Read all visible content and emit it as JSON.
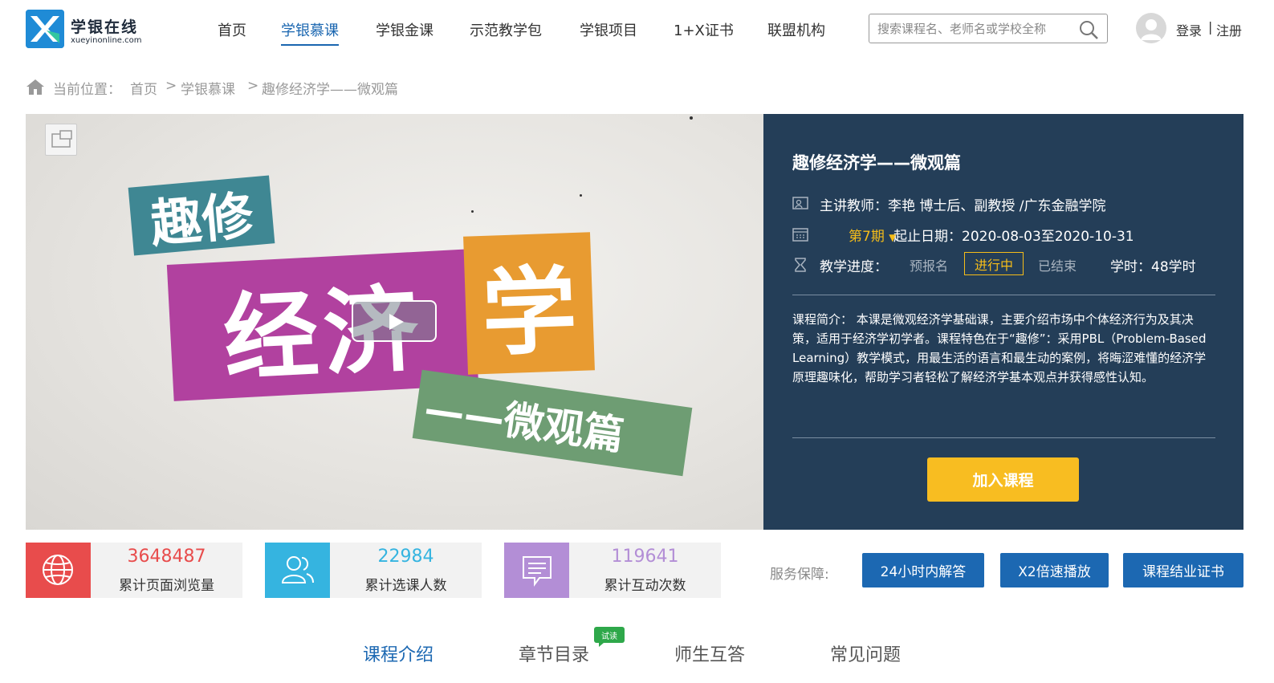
{
  "header": {
    "logo_title": "学银在线",
    "logo_sub": "xueyinonline.com",
    "nav": [
      {
        "label": "首页"
      },
      {
        "label": "学银慕课"
      },
      {
        "label": "学银金课"
      },
      {
        "label": "示范教学包"
      },
      {
        "label": "学银项目"
      },
      {
        "label": "1+X证书"
      },
      {
        "label": "联盟机构"
      }
    ],
    "search_placeholder": "搜索课程名、老师名或学校全称",
    "login": "登录",
    "separator": "|",
    "register": "注册"
  },
  "breadcrumb": {
    "label": "当前位置：",
    "items": [
      "首页",
      "学银慕课",
      "趣修经济学——微观篇"
    ],
    "sep": ">"
  },
  "video": {
    "card_teal": "趣修",
    "card_magenta": "经济",
    "card_orange": "学",
    "card_green": "——微观篇"
  },
  "course": {
    "title": "趣修经济学——微观篇",
    "teacher": "主讲教师：李艳 博士后、副教授 /广东金融学院",
    "term": "第7期",
    "date_label": "起止日期：2020-08-03至2020-10-31",
    "progress_label": "教学进度：",
    "status_signup": "预报名",
    "status_active": "进行中",
    "status_ended": "已结束",
    "hours": "学时：48学时",
    "intro": "课程简介： 本课是微观经济学基础课，主要介绍市场中个体经济行为及其决策，适用于经济学初学者。课程特色在于“趣修”：采用PBL（Problem-Based Learning）教学模式，用最生活的语言和最生动的案例，将晦涩难懂的经济学原理趣味化，帮助学习者轻松了解经济学基本观点并获得感性认知。",
    "join_button": "加入课程"
  },
  "stats": [
    {
      "value": "3648487",
      "label": "累计页面浏览量",
      "color": "#e84c4c"
    },
    {
      "value": "22984",
      "label": "累计选课人数",
      "color": "#35b4e0"
    },
    {
      "value": "119641",
      "label": "累计互动次数",
      "color": "#b38ed6"
    }
  ],
  "service": {
    "label": "服务保障:",
    "buttons": [
      "24小时内解答",
      "X2倍速播放",
      "课程结业证书"
    ]
  },
  "tabs": [
    {
      "label": "课程介绍"
    },
    {
      "label": "章节目录"
    },
    {
      "label": "师生互答"
    },
    {
      "label": "常见问题"
    }
  ],
  "trial_badge": "试读",
  "colors": {
    "accent": "#1c68b2",
    "panel": "#243e58",
    "highlight": "#f6bd19"
  }
}
